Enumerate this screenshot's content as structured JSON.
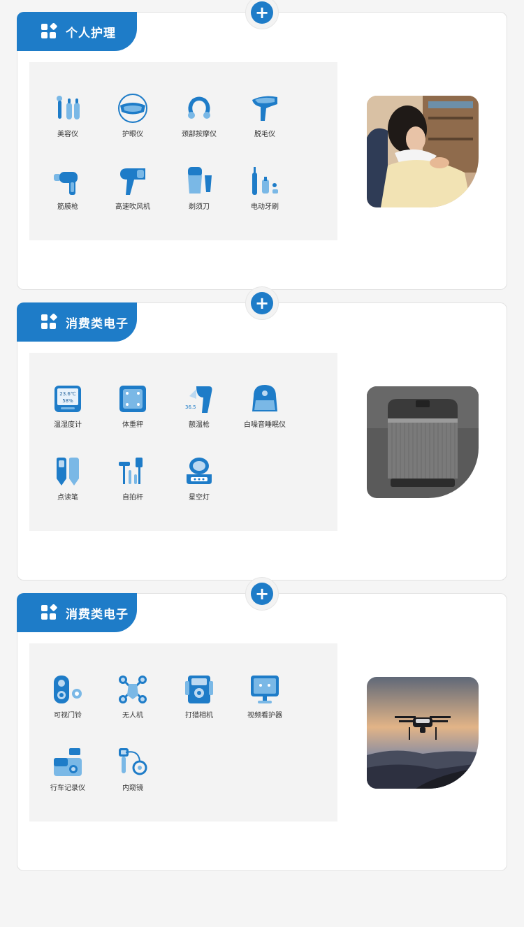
{
  "colors": {
    "accent": "#1e7cc8",
    "accent_light": "#7ab8e6",
    "page_bg": "#f5f5f5",
    "panel_bg": "#f3f3f3"
  },
  "add_button_label": "+",
  "sections": [
    {
      "title": "个人护理",
      "photo_icon": "woman-neck-massager-photo",
      "items": [
        {
          "label": "美容仪",
          "icon": "beauty-device-icon"
        },
        {
          "label": "护眼仪",
          "icon": "eye-massager-icon"
        },
        {
          "label": "颈部按摩仪",
          "icon": "neck-massager-icon"
        },
        {
          "label": "脱毛仪",
          "icon": "hair-removal-icon"
        },
        {
          "label": "筋膜枪",
          "icon": "massage-gun-icon"
        },
        {
          "label": "高速吹风机",
          "icon": "hair-dryer-icon"
        },
        {
          "label": "剃须刀",
          "icon": "shaver-icon"
        },
        {
          "label": "电动牙刷",
          "icon": "electric-toothbrush-icon"
        }
      ]
    },
    {
      "title": "消费类电子",
      "photo_icon": "speaker-photo",
      "items": [
        {
          "label": "温湿度计",
          "icon": "hygrometer-icon",
          "readout": [
            "23.6℃",
            "58%"
          ]
        },
        {
          "label": "体重秤",
          "icon": "scale-icon"
        },
        {
          "label": "额温枪",
          "icon": "thermometer-gun-icon",
          "readout": [
            "36.5℃"
          ]
        },
        {
          "label": "白噪音睡眠仪",
          "icon": "white-noise-icon"
        },
        {
          "label": "点读笔",
          "icon": "reading-pen-icon"
        },
        {
          "label": "自拍杆",
          "icon": "selfie-stick-icon"
        },
        {
          "label": "星空灯",
          "icon": "star-projector-icon"
        }
      ]
    },
    {
      "title": "消费类电子",
      "photo_icon": "drone-photo",
      "items": [
        {
          "label": "可视门铃",
          "icon": "video-doorbell-icon"
        },
        {
          "label": "无人机",
          "icon": "drone-icon"
        },
        {
          "label": "打猎相机",
          "icon": "trail-camera-icon"
        },
        {
          "label": "视频看护器",
          "icon": "baby-monitor-icon"
        },
        {
          "label": "行车记录仪",
          "icon": "dash-cam-icon"
        },
        {
          "label": "内窥镜",
          "icon": "endoscope-icon"
        }
      ]
    }
  ]
}
